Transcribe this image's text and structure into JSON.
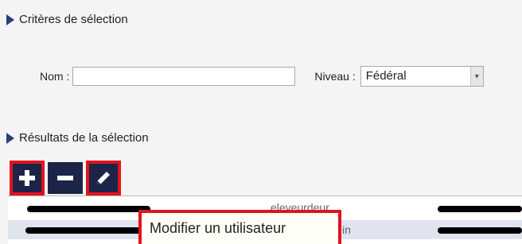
{
  "criteria": {
    "title": "Critères de sélection"
  },
  "form": {
    "nom_label": "Nom :",
    "nom_value": "",
    "niveau_label": "Niveau :",
    "niveau_value": "Fédéral"
  },
  "results": {
    "title": "Résultats de la sélection"
  },
  "toolbar": {
    "add_icon": "plus-icon",
    "remove_icon": "minus-icon",
    "edit_icon": "pencil-icon"
  },
  "table": {
    "rows": [
      {
        "c1": "",
        "c2": "eleveurdeur",
        "c3": ""
      },
      {
        "c1": "",
        "c2": "in",
        "c3": ""
      }
    ]
  },
  "tooltip": {
    "text": "Modifier un utilisateur"
  },
  "colors": {
    "toolbar_bg": "#1c2547",
    "highlight": "#e0141e",
    "selected_row": "#dfe3ee"
  }
}
